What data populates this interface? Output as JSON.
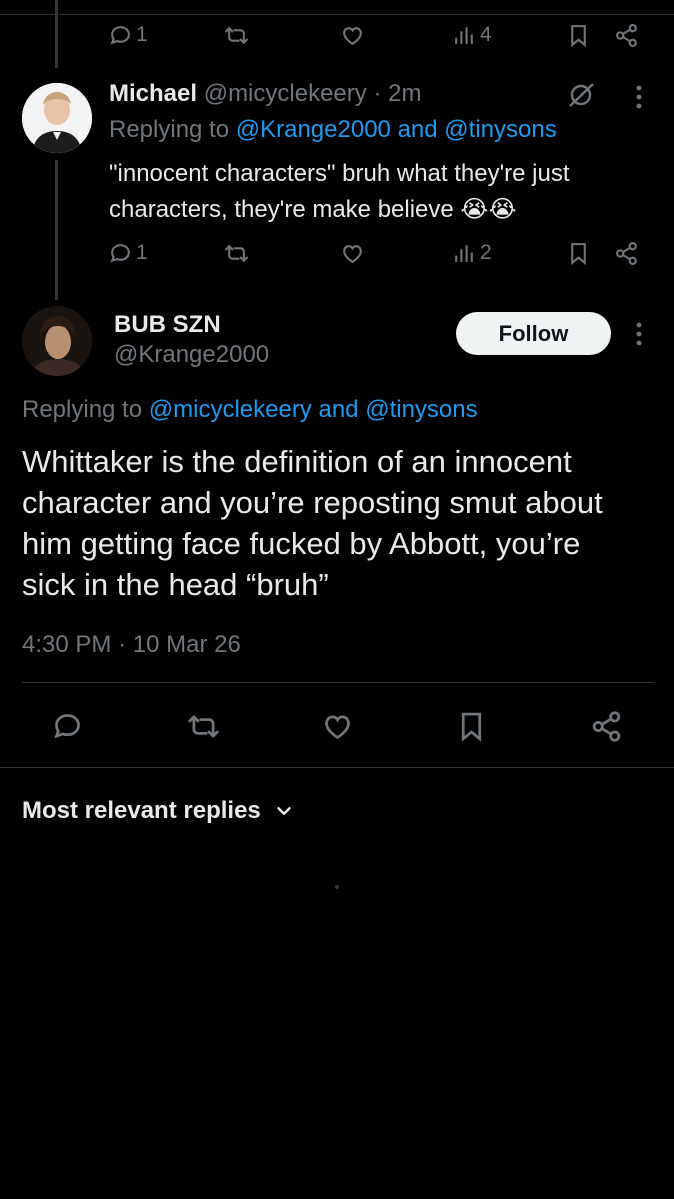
{
  "reply1": {
    "action_counts": {
      "replies": "1",
      "views": "4"
    }
  },
  "reply2": {
    "name": "Michael",
    "handle": "@micyclekeery",
    "dot": "·",
    "time": "2m",
    "replying_prefix": "Replying to",
    "replying_user1": "@Krange2000",
    "replying_and": "and",
    "replying_user2": "@tinysons",
    "text_line1": "\"innocent characters\" bruh what they're just",
    "text_line2": "characters, they're make believe 😭😭",
    "action_counts": {
      "replies": "1",
      "views": "2"
    }
  },
  "main_post": {
    "name": "BUB SZN",
    "handle": "@Krange2000",
    "follow_label": "Follow",
    "replying_prefix": "Replying to",
    "replying_user1": "@micyclekeery",
    "replying_and": "and",
    "replying_user2": "@tinysons",
    "text_line1": "Whittaker is the definition of an innocent",
    "text_line2": "character and you’re reposting smut about",
    "text_line3": "him getting face fucked by Abbott, you’re",
    "text_line4": "sick in the head “bruh”",
    "time": "4:30 PM",
    "dot": "·",
    "date": "10 Mar 26"
  },
  "replies_sort": {
    "label": "Most relevant replies"
  },
  "colors": {
    "background": "#000000",
    "text": "#e7e9ea",
    "secondary": "#71767b",
    "link": "#1d9bf0",
    "divider": "#2f3336"
  },
  "icons": [
    "reply-icon",
    "repost-icon",
    "like-icon",
    "views-icon",
    "bookmark-icon",
    "share-icon",
    "more-icon",
    "grok-icon",
    "chevron-down-icon"
  ]
}
